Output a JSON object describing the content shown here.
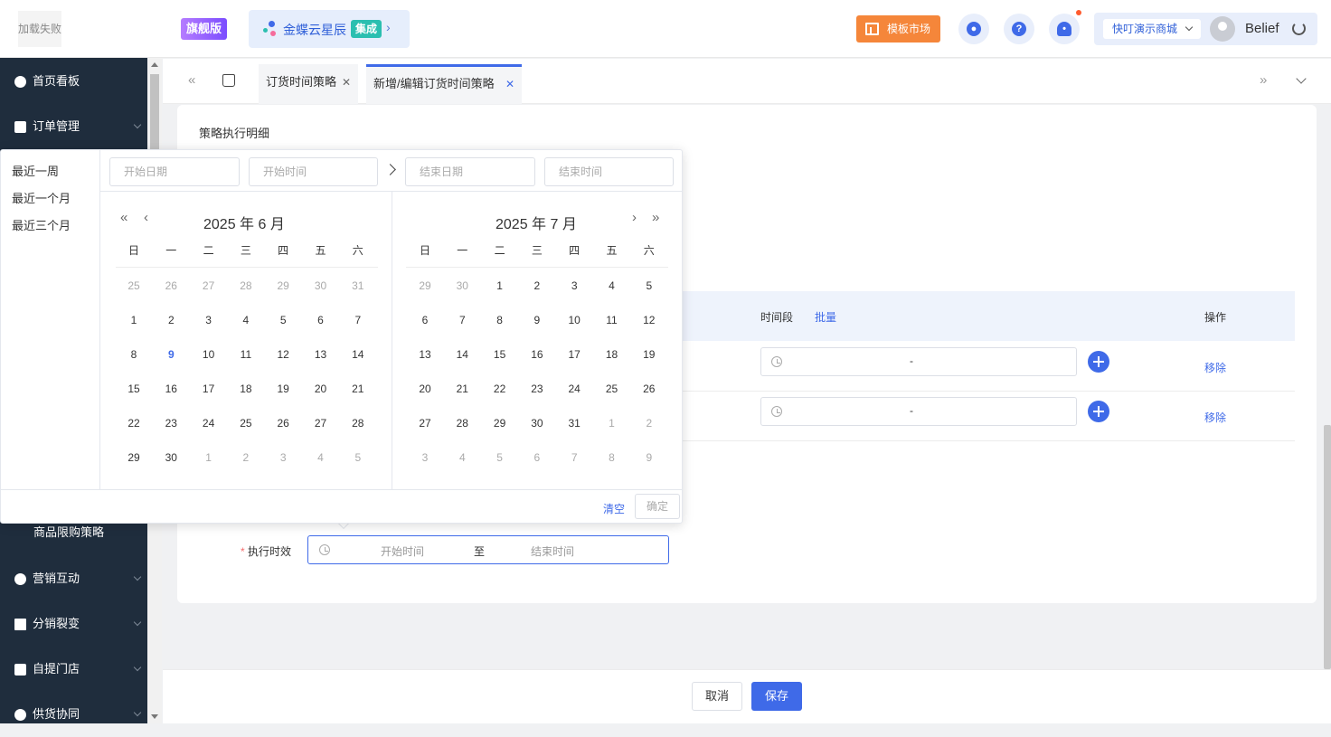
{
  "header": {
    "logo_text": "加载失败",
    "edition": "旗舰版",
    "brand_name": "金蝶云星辰",
    "brand_tag": "集成",
    "template_button": "模板市场",
    "store_name": "快叮演示商城",
    "username": "Belief"
  },
  "sidebar": {
    "items": [
      {
        "label": "首页看板"
      },
      {
        "label": "订单管理"
      },
      {
        "label": "营销互动"
      },
      {
        "label": "分销裂变"
      },
      {
        "label": "自提门店"
      },
      {
        "label": "供货协同"
      }
    ],
    "sub_item": "商品限购策略"
  },
  "tabs": [
    {
      "label": "订货时间策略"
    },
    {
      "label": "新增/编辑订货时间策略"
    }
  ],
  "content": {
    "section_title": "策略执行明细",
    "table": {
      "col_time": "时间段",
      "col_batch": "批量",
      "col_action": "操作",
      "rows": [
        {
          "range_sep": "-",
          "remove": "移除"
        },
        {
          "range_sep": "-",
          "remove": "移除"
        }
      ]
    },
    "exec_label": "执行时效",
    "exec_required": "*",
    "exec_start_placeholder": "开始时间",
    "exec_sep": "至",
    "exec_end_placeholder": "结束时间"
  },
  "footer": {
    "cancel": "取消",
    "save": "保存"
  },
  "datepicker": {
    "shortcuts": [
      "最近一周",
      "最近一个月",
      "最近三个月"
    ],
    "start_date_ph": "开始日期",
    "start_time_ph": "开始时间",
    "end_date_ph": "结束日期",
    "end_time_ph": "结束时间",
    "weekdays": [
      "日",
      "一",
      "二",
      "三",
      "四",
      "五",
      "六"
    ],
    "left_title": "2025 年 6 月",
    "right_title": "2025 年 7 月",
    "left_days": [
      25,
      26,
      27,
      28,
      29,
      30,
      31,
      1,
      2,
      3,
      4,
      5,
      6,
      7,
      8,
      9,
      10,
      11,
      12,
      13,
      14,
      15,
      16,
      17,
      18,
      19,
      20,
      21,
      22,
      23,
      24,
      25,
      26,
      27,
      28,
      29,
      30,
      1,
      2,
      3,
      4,
      5
    ],
    "left_first_in_month": 7,
    "left_last_in_month": 36,
    "right_days": [
      29,
      30,
      1,
      2,
      3,
      4,
      5,
      6,
      7,
      8,
      9,
      10,
      11,
      12,
      13,
      14,
      15,
      16,
      17,
      18,
      19,
      20,
      21,
      22,
      23,
      24,
      25,
      26,
      27,
      28,
      29,
      30,
      31,
      1,
      2,
      3,
      4,
      5,
      6,
      7,
      8,
      9
    ],
    "right_first_in_month": 2,
    "right_last_in_month": 32,
    "today_index_left": 15,
    "clear": "清空",
    "confirm": "确定"
  }
}
